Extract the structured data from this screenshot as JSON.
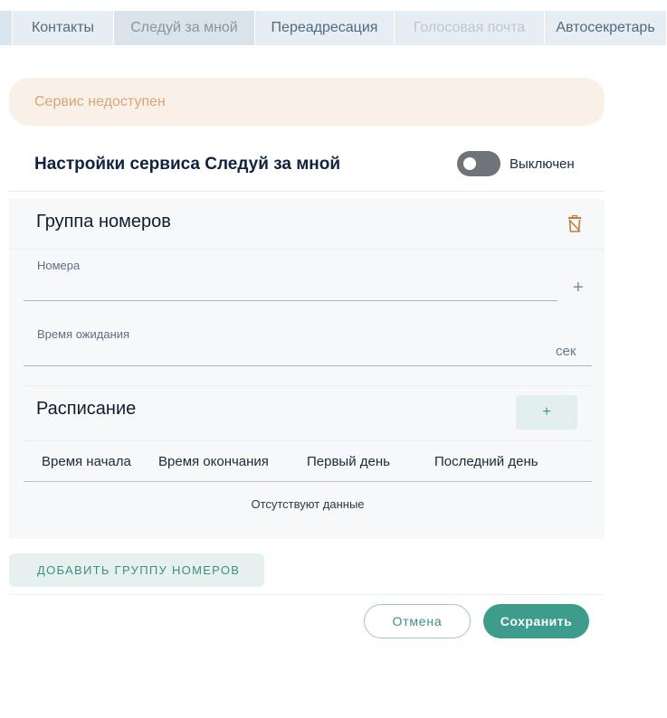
{
  "tabs": [
    {
      "label": "Контакты"
    },
    {
      "label": "Следуй за мной"
    },
    {
      "label": "Переадресация"
    },
    {
      "label": "Голосовая почта"
    },
    {
      "label": "Автосекретарь"
    }
  ],
  "banner": {
    "text": "Сервис недоступен"
  },
  "service": {
    "title": "Настройки сервиса Следуй за мной",
    "toggle_label": "Выключен",
    "enabled": false
  },
  "group": {
    "title": "Группа номеров",
    "numbers_label": "Номера",
    "numbers_value": "",
    "wait_label": "Время ожидания",
    "wait_value": "",
    "wait_unit": "сек"
  },
  "schedule": {
    "title": "Расписание",
    "add_label": "+",
    "columns": [
      "Время начала",
      "Время окончания",
      "Первый день",
      "Последний день"
    ],
    "empty_text": "Отсутствуют данные"
  },
  "actions": {
    "add_group": "ДОБАВИТЬ ГРУППУ НОМЕРОВ",
    "cancel": "Отмена",
    "save": "Сохранить"
  },
  "colors": {
    "accent": "#3e9c8c",
    "banner_bg": "#f9f1e8",
    "banner_text": "#d9a476",
    "toggle_off": "#6e7479",
    "trash_icon": "#c87a3a"
  }
}
